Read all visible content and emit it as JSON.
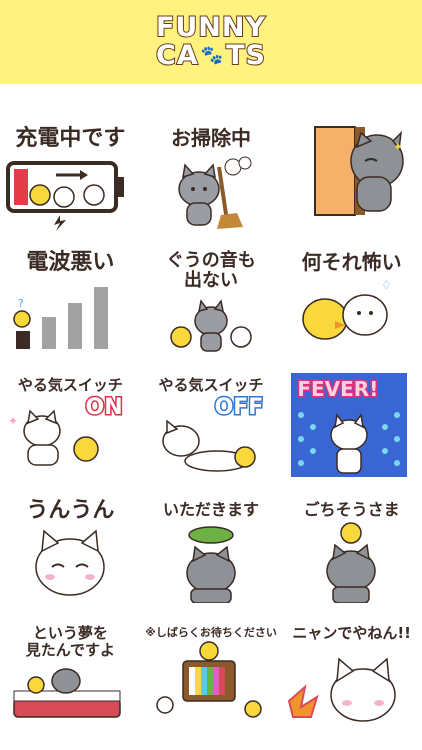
{
  "header": {
    "line1": "FUNNY",
    "line2a": "CA",
    "line2b": "TS"
  },
  "stickers": [
    {
      "caption": "充電中です"
    },
    {
      "caption": "お掃除中"
    },
    {
      "caption": ""
    },
    {
      "caption": "電波悪い"
    },
    {
      "caption": "ぐうの音も\n出ない"
    },
    {
      "caption": "何それ怖い"
    },
    {
      "caption": "やる気スイッチ",
      "badge": "ON"
    },
    {
      "caption": "やる気スイッチ",
      "badge": "OFF"
    },
    {
      "caption": "",
      "badge": "FEVER!"
    },
    {
      "caption": "うんうん"
    },
    {
      "caption": "いただきます"
    },
    {
      "caption": "ごちそうさま"
    },
    {
      "caption": "という夢を\n見たんですよ"
    },
    {
      "caption": "※しばらくお待ちください"
    },
    {
      "caption": "ニャンでやねん!!"
    }
  ],
  "colors": {
    "header_bg": "#fff27e",
    "text": "#3b2b24",
    "cat_gray": "#9a9da3",
    "chick_yellow": "#f8d83a"
  }
}
